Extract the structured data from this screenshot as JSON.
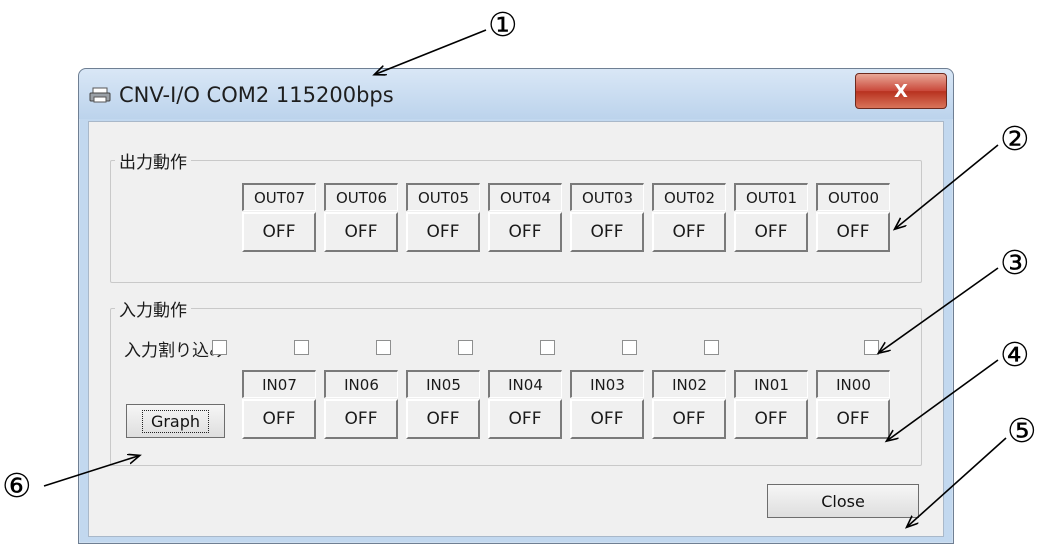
{
  "annotations": [
    "①",
    "②",
    "③",
    "④",
    "⑤",
    "⑥"
  ],
  "window": {
    "title": "CNV-I/O COM2 115200bps",
    "close_glyph": "X",
    "icon": "printer-icon"
  },
  "output_group": {
    "label": "出力動作",
    "channels": [
      {
        "name": "OUT07",
        "state": "OFF"
      },
      {
        "name": "OUT06",
        "state": "OFF"
      },
      {
        "name": "OUT05",
        "state": "OFF"
      },
      {
        "name": "OUT04",
        "state": "OFF"
      },
      {
        "name": "OUT03",
        "state": "OFF"
      },
      {
        "name": "OUT02",
        "state": "OFF"
      },
      {
        "name": "OUT01",
        "state": "OFF"
      },
      {
        "name": "OUT00",
        "state": "OFF"
      }
    ]
  },
  "input_group": {
    "label": "入力動作",
    "interrupt_label": "入力割り込み",
    "channels": [
      {
        "name": "IN07",
        "state": "OFF",
        "interrupt": false
      },
      {
        "name": "IN06",
        "state": "OFF",
        "interrupt": false
      },
      {
        "name": "IN05",
        "state": "OFF",
        "interrupt": false
      },
      {
        "name": "IN04",
        "state": "OFF",
        "interrupt": false
      },
      {
        "name": "IN03",
        "state": "OFF",
        "interrupt": false
      },
      {
        "name": "IN02",
        "state": "OFF",
        "interrupt": false
      },
      {
        "name": "IN01",
        "state": "OFF",
        "interrupt": false
      },
      {
        "name": "IN00",
        "state": "OFF",
        "interrupt": false
      }
    ],
    "graph_label": "Graph"
  },
  "footer": {
    "close_label": "Close"
  }
}
